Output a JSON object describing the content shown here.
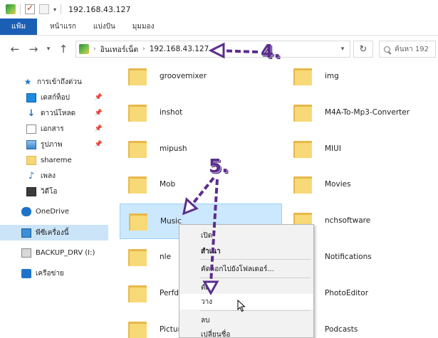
{
  "titlebar": {
    "title": "192.168.43.127"
  },
  "ribbon": {
    "tabs": [
      {
        "label": "แฟ้ม"
      },
      {
        "label": "หน้าแรก"
      },
      {
        "label": "แบ่งปัน"
      },
      {
        "label": "มุมมอง"
      }
    ]
  },
  "address": {
    "crumbs": [
      "อินเทอร์เน็ต",
      "192.168.43.127"
    ],
    "search_placeholder": "ค้นหา 192"
  },
  "sidebar": {
    "items": [
      {
        "label": "การเข้าถึงด่วน",
        "icon": "star-icon"
      },
      {
        "label": "เดสก์ท็อป",
        "icon": "desktop-icon",
        "pinned": true
      },
      {
        "label": "ดาวน์โหลด",
        "icon": "download-icon",
        "pinned": true
      },
      {
        "label": "เอกสาร",
        "icon": "document-icon",
        "pinned": true
      },
      {
        "label": "รูปภาพ",
        "icon": "pictures-icon",
        "pinned": true
      },
      {
        "label": "shareme",
        "icon": "folder-icon"
      },
      {
        "label": "เพลง",
        "icon": "music-icon"
      },
      {
        "label": "วิดีโอ",
        "icon": "video-icon"
      },
      {
        "label": "OneDrive",
        "icon": "cloud-icon"
      },
      {
        "label": "พีซีเครื่องนี้",
        "icon": "computer-icon",
        "selected": true
      },
      {
        "label": "BACKUP_DRV (I:)",
        "icon": "drive-icon"
      },
      {
        "label": "เครือข่าย",
        "icon": "network-icon"
      }
    ]
  },
  "files": {
    "left": [
      "groovemixer",
      "inshot",
      "mipush",
      "Mob",
      "Music",
      "nle",
      "Perfdu",
      "Picture"
    ],
    "right": [
      "img",
      "M4A-To-Mp3-Converter",
      "MIUI",
      "Movies",
      "nchsoftware",
      "Notifications",
      "PhotoEditor",
      "Podcasts"
    ],
    "selected": "Music"
  },
  "context_menu": {
    "items": [
      {
        "label": "เปิด"
      },
      {
        "label": "สำเนา",
        "bold": true
      },
      {
        "label": "คัดลอกไปยังโฟลเดอร์..."
      },
      {
        "label": "ตัด"
      },
      {
        "label": "วาง",
        "hover": true
      },
      {
        "label": "ลบ"
      },
      {
        "label": "เปลี่ยนชื่อ"
      }
    ]
  },
  "annotations": {
    "step4": "4.",
    "step5": "5."
  },
  "colors": {
    "accent": "#1a5fb4",
    "selection": "#cce8ff",
    "annotation": "#5b2d8e"
  }
}
